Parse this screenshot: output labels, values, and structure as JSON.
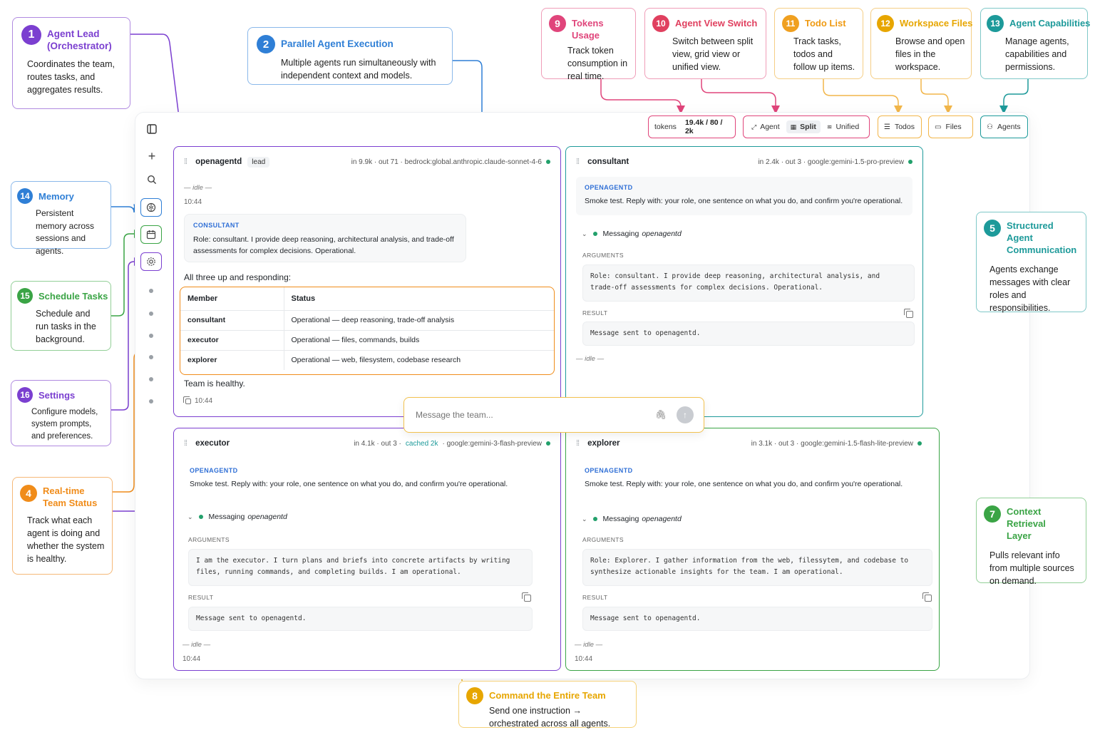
{
  "colors": {
    "purple": "#7b3fd0",
    "blue": "#2f7fd6",
    "orange": "#f08c1a",
    "amber": "#e7a600",
    "teal": "#1d9a9a",
    "green": "#3aa445",
    "pink": "#e0457b",
    "red": "#e0405f",
    "tan": "#f2b64a"
  },
  "callouts": {
    "c1": {
      "num": "1",
      "title_line1": "Agent Lead",
      "title_line2": "(Orchestrator)",
      "desc": "Coordinates the team, routes tasks, and aggregates results."
    },
    "c2": {
      "num": "2",
      "title": "Parallel Agent Execution",
      "desc": "Multiple agents run simultaneously with independent context and models."
    },
    "c4": {
      "num": "4",
      "title_line1": "Real-time",
      "title_line2": "Team Status",
      "desc": "Track what each agent is doing and whether the system is healthy."
    },
    "c5": {
      "num": "5",
      "title_line1": "Structured Agent",
      "title_line2": "Communication",
      "desc": "Agents exchange messages with clear roles and responsibilities."
    },
    "c7": {
      "num": "7",
      "title_line1": "Context Retrieval",
      "title_line2": "Layer",
      "desc": "Pulls relevant info from multiple sources on demand."
    },
    "c8": {
      "num": "8",
      "title": "Command the Entire Team",
      "desc": "Send one instruction → orchestrated across all agents."
    },
    "c9": {
      "num": "9",
      "title": "Tokens Usage",
      "desc": "Track token consumption in real time."
    },
    "c10": {
      "num": "10",
      "title": "Agent View Switch",
      "desc": "Switch between split view, grid view or unified view."
    },
    "c11": {
      "num": "11",
      "title": "Todo List",
      "desc": "Track tasks, todos and follow up items."
    },
    "c12": {
      "num": "12",
      "title": "Workspace Files",
      "desc": "Browse and open files in the workspace."
    },
    "c13": {
      "num": "13",
      "title": "Agent Capabilities",
      "desc": "Manage agents, capabilities and permissions."
    },
    "c14": {
      "num": "14",
      "title": "Memory",
      "desc": "Persistent memory across sessions and agents."
    },
    "c15": {
      "num": "15",
      "title": "Schedule Tasks",
      "desc": "Schedule and run tasks in the background."
    },
    "c16": {
      "num": "16",
      "title": "Settings",
      "desc": "Configure models, system prompts, and preferences."
    }
  },
  "toolbar": {
    "tokens_label": "tokens",
    "tokens_value": "19.4k / 80 / 2k",
    "agent_label": "Agent",
    "split_label": "Split",
    "unified_label": "Unified",
    "todos_label": "Todos",
    "files_label": "Files",
    "agents_label": "Agents"
  },
  "lead_panel": {
    "name": "openagentd",
    "badge": "lead",
    "meta": "in 9.9k · out 71 · bedrock:global.anthropic.claude-sonnet-4-6",
    "idle": "— idle —",
    "time1": "10:44",
    "consultant_label": "CONSULTANT",
    "consultant_text": "Role: consultant. I provide deep reasoning, architectural analysis, and trade-off assessments for complex decisions. Operational.",
    "summary": "All three up and responding:",
    "table_headers": [
      "Member",
      "Status"
    ],
    "table_rows": [
      {
        "member": "consultant",
        "status": "Operational — deep reasoning, trade-off analysis"
      },
      {
        "member": "executor",
        "status": "Operational — files, commands, builds"
      },
      {
        "member": "explorer",
        "status": "Operational — web, filesystem, codebase research"
      }
    ],
    "healthy": "Team is healthy.",
    "time2": "10:44"
  },
  "consultant_panel": {
    "name": "consultant",
    "meta": "in 2.4k · out 3 · google:gemini-1.5-pro-preview",
    "from_label": "OPENAGENTD",
    "prompt": "Smoke test. Reply with: your role, one sentence on what you do, and confirm you're operational.",
    "messaging_prefix": "Messaging",
    "messaging_target": "openagentd",
    "arguments_label": "ARGUMENTS",
    "arguments": "Role: consultant. I provide deep reasoning, architectural analysis, and trade-off assessments for complex decisions. Operational.",
    "result_label": "RESULT",
    "result": "Message sent to openagentd.",
    "idle": "— idle —"
  },
  "executor_panel": {
    "name": "executor",
    "meta_prefix": "in 4.1k · out 3 ·",
    "meta_cached": "cached 2k",
    "meta_suffix": "· google:gemini-3-flash-preview",
    "from_label": "OPENAGENTD",
    "prompt": "Smoke test. Reply with: your role, one sentence on what you do, and confirm you're operational.",
    "messaging_prefix": "Messaging",
    "messaging_target": "openagentd",
    "arguments_label": "ARGUMENTS",
    "arguments": "I am the executor. I turn plans and briefs into concrete artifacts by writing files, running commands, and completing builds. I am operational.",
    "result_label": "RESULT",
    "result": "Message sent to openagentd.",
    "idle": "— idle —",
    "time": "10:44"
  },
  "explorer_panel": {
    "name": "explorer",
    "meta": "in 3.1k · out 3 · google:gemini-1.5-flash-lite-preview",
    "from_label": "OPENAGENTD",
    "prompt": "Smoke test. Reply with: your role, one sentence on what you do, and confirm you're operational.",
    "messaging_prefix": "Messaging",
    "messaging_target": "openagentd",
    "arguments_label": "ARGUMENTS",
    "arguments": "Role: Explorer. I gather information from the web, filessytem, and codebase to synthesize actionable insights for the team. I am operational.",
    "result_label": "RESULT",
    "result": "Message sent to openagentd.",
    "idle": "— idle —",
    "time": "10:44"
  },
  "composer": {
    "placeholder": "Message the team..."
  },
  "icons": {
    "sidebar_toggle": "sidebar-toggle-icon",
    "new": "plus-icon",
    "search": "search-icon",
    "memory": "brain-icon",
    "schedule": "calendar-icon",
    "settings": "gear-icon",
    "attach": "paperclip-icon",
    "send": "arrow-up-icon",
    "copy": "copy-icon",
    "grip": "drag-handle-icon"
  }
}
